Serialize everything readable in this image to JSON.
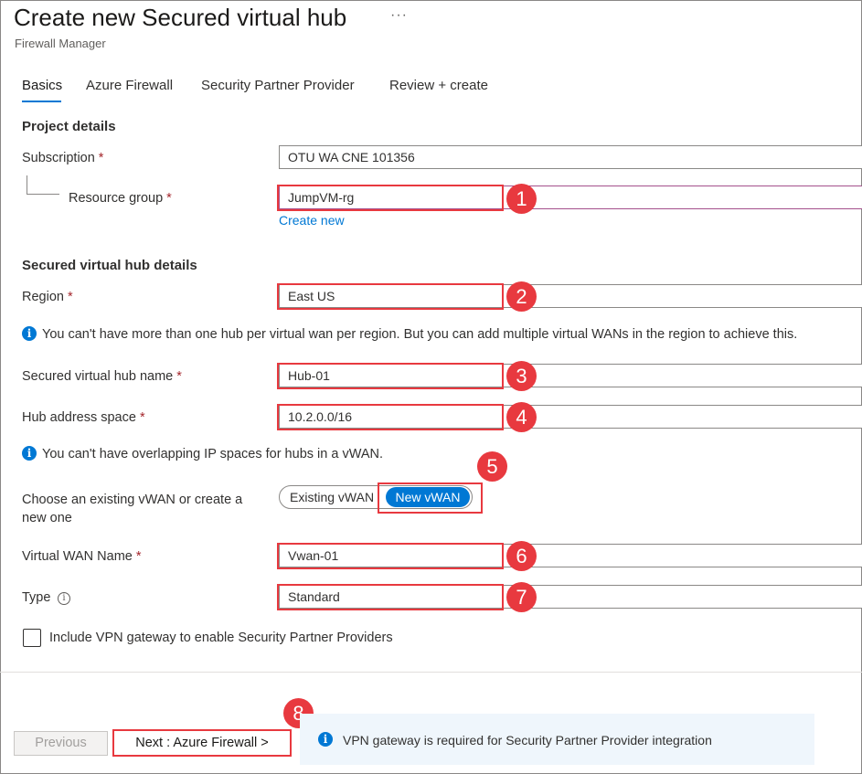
{
  "header": {
    "title": "Create new Secured virtual hub",
    "more": "···",
    "subtitle": "Firewall Manager"
  },
  "tabs": [
    {
      "label": "Basics",
      "active": true
    },
    {
      "label": "Azure Firewall",
      "active": false
    },
    {
      "label": "Security Partner Provider",
      "active": false
    },
    {
      "label": "Review + create",
      "active": false
    }
  ],
  "project": {
    "heading": "Project details",
    "subscription_label": "Subscription",
    "subscription_value": "OTU WA CNE 101356",
    "resource_group_label": "Resource group",
    "resource_group_value": "JumpVM-rg",
    "create_new": "Create new"
  },
  "hub": {
    "heading": "Secured virtual hub details",
    "region_label": "Region",
    "region_value": "East US",
    "region_info": "You can't have more than one hub per virtual wan per region. But you can add multiple virtual WANs in the region to achieve this.",
    "name_label": "Secured virtual hub name",
    "name_value": "Hub-01",
    "address_label": "Hub address space",
    "address_value": "10.2.0.0/16",
    "address_info": "You can't have overlapping IP spaces for hubs in a vWAN.",
    "vwan_choice_label": "Choose an existing vWAN or create a new one",
    "vwan_option_existing": "Existing vWAN",
    "vwan_option_new": "New vWAN",
    "vwan_selected": "New vWAN",
    "vwan_name_label": "Virtual WAN Name",
    "vwan_name_value": "Vwan-01",
    "type_label": "Type",
    "type_value": "Standard",
    "vpn_checkbox_label": "Include VPN gateway to enable Security Partner Providers",
    "vpn_checked": false
  },
  "required_mark": "*",
  "info_glyph": "i",
  "badges": [
    "1",
    "2",
    "3",
    "4",
    "5",
    "6",
    "7",
    "8"
  ],
  "footer": {
    "previous_label": "Previous",
    "next_label": "Next : Azure Firewall >",
    "banner_text": "VPN gateway is required for Security Partner Provider integration"
  },
  "colors": {
    "accent": "#0078d4",
    "highlight": "#e8393f",
    "required": "#a4262c"
  }
}
